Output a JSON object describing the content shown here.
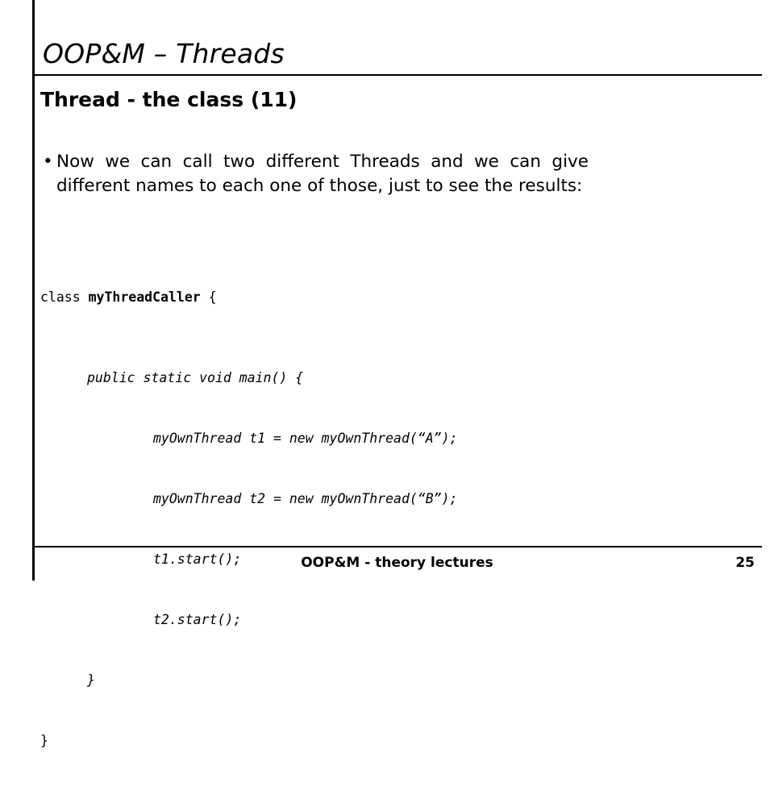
{
  "slide": {
    "title": "OOP&M – Threads",
    "subtitle": "Thread - the class (11)",
    "bullet_marker": "•",
    "bullet_text": "Now we can call two different Threads and we can give different names to each one of those, just to see the results:",
    "code": {
      "line1_keyword": "class ",
      "line1_classname": "myThreadCaller",
      "line1_brace": " {",
      "line2": "public static void main() {",
      "line3": "myOwnThread t1 = new myOwnThread(“A”);",
      "line4": "myOwnThread t2 = new myOwnThread(“B”);",
      "line5": "t1.start();",
      "line6": "t2.start();",
      "line7": "}",
      "line8": "}"
    },
    "footer": {
      "text": "OOP&M - theory lectures",
      "page_number": "25"
    }
  }
}
